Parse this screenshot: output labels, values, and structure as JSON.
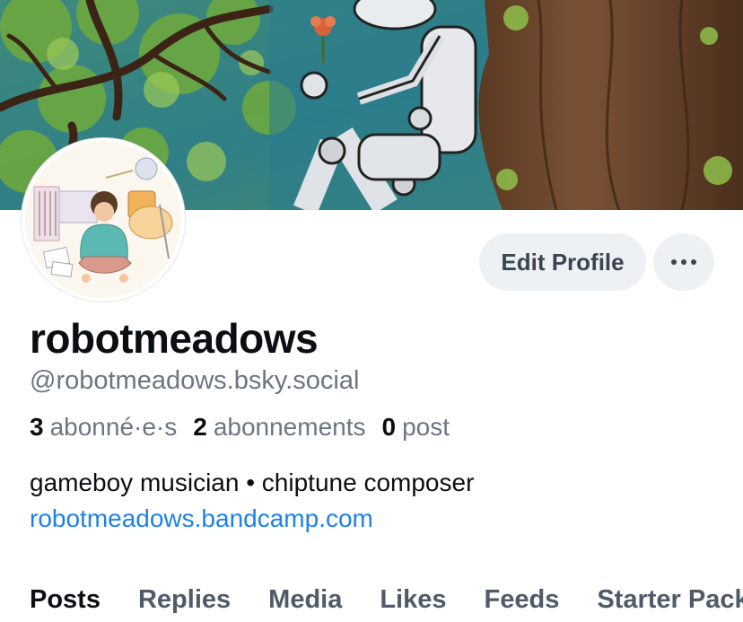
{
  "profile": {
    "display_name": "robotmeadows",
    "handle": "@robotmeadows.bsky.social",
    "bio": "gameboy musician • chiptune composer",
    "link": "robotmeadows.bandcamp.com"
  },
  "actions": {
    "edit_profile_label": "Edit Profile",
    "more_icon": "ellipsis-icon"
  },
  "stats": {
    "followers_count": "3",
    "followers_label": "abonné·e·s",
    "following_count": "2",
    "following_label": "abonnements",
    "posts_count": "0",
    "posts_label": "post"
  },
  "tabs": [
    {
      "label": "Posts",
      "active": true
    },
    {
      "label": "Replies",
      "active": false
    },
    {
      "label": "Media",
      "active": false
    },
    {
      "label": "Likes",
      "active": false
    },
    {
      "label": "Feeds",
      "active": false
    },
    {
      "label": "Starter Packs",
      "active": false
    }
  ],
  "colors": {
    "link": "#1d82e8",
    "muted_text": "#6b7684",
    "button_bg": "#eef1f4",
    "primary_text": "#0b0f14"
  }
}
